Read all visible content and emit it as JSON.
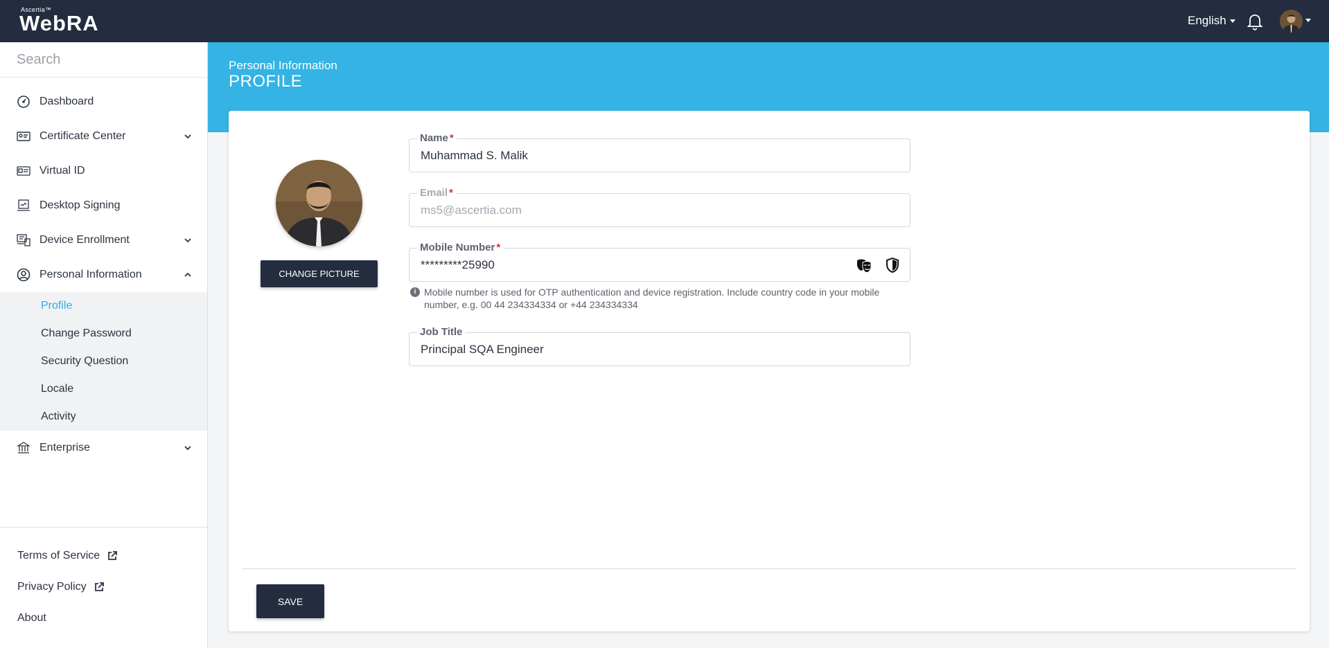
{
  "header": {
    "brand_small": "Ascertia™",
    "brand_name": "WebRA",
    "language": "English"
  },
  "sidebar": {
    "search_placeholder": "Search",
    "items": [
      {
        "label": "Dashboard",
        "icon": "dashboard-icon"
      },
      {
        "label": "Certificate Center",
        "icon": "certificate-icon",
        "expandable": true
      },
      {
        "label": "Virtual ID",
        "icon": "id-card-icon"
      },
      {
        "label": "Desktop Signing",
        "icon": "signing-icon"
      },
      {
        "label": "Device Enrollment",
        "icon": "device-icon",
        "expandable": true
      },
      {
        "label": "Personal Information",
        "icon": "user-circle-icon",
        "expanded": true
      },
      {
        "label": "Enterprise",
        "icon": "bank-icon",
        "expandable": true
      }
    ],
    "submenu": [
      {
        "label": "Profile",
        "active": true
      },
      {
        "label": "Change Password"
      },
      {
        "label": "Security Question"
      },
      {
        "label": "Locale"
      },
      {
        "label": "Activity"
      }
    ],
    "footer": [
      {
        "label": "Terms of Service"
      },
      {
        "label": "Privacy Policy"
      },
      {
        "label": "About"
      }
    ]
  },
  "page": {
    "breadcrumb": "Personal Information",
    "title": "PROFILE"
  },
  "profile": {
    "change_picture_label": "CHANGE PICTURE",
    "name_label": "Name",
    "name_value": "Muhammad S. Malik",
    "email_label": "Email",
    "email_value": "ms5@ascertia.com",
    "mobile_label": "Mobile Number",
    "mobile_value": "*********25990",
    "mobile_hint": "Mobile number is used for OTP authentication and device registration. Include country code in your mobile number, e.g. 00 44 234334334 or +44 234334334",
    "job_label": "Job Title",
    "job_value": "Principal SQA Engineer",
    "required_mark": "*",
    "save_label": "SAVE"
  },
  "colors": {
    "topbar": "#232d3f",
    "banner": "#34b3e4",
    "accent": "#2aaee4",
    "required": "#d0342c"
  }
}
